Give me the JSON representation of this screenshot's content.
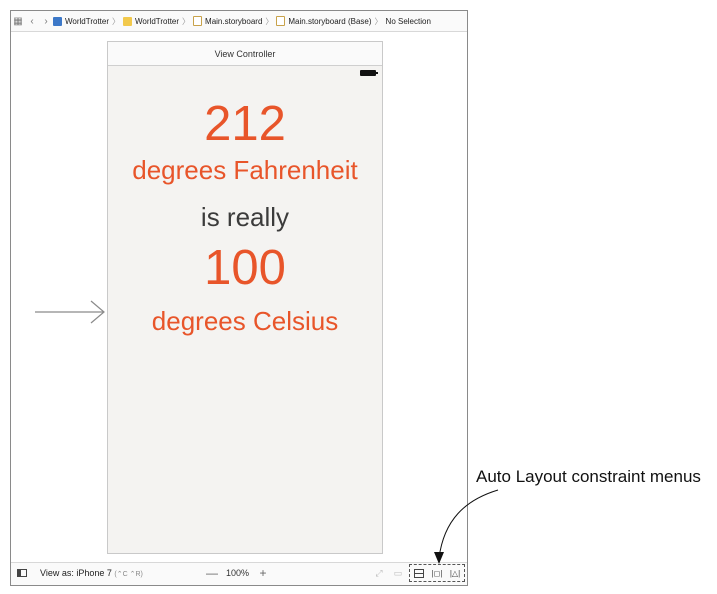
{
  "jumpbar": {
    "crumbs": [
      {
        "label": "WorldTrotter",
        "icon": "project-icon"
      },
      {
        "label": "WorldTrotter",
        "icon": "folder-icon"
      },
      {
        "label": "Main.storyboard",
        "icon": "storyboard-file-icon"
      },
      {
        "label": "Main.storyboard (Base)",
        "icon": "storyboard-file-icon"
      },
      {
        "label": "No Selection"
      }
    ]
  },
  "scene": {
    "title": "View Controller",
    "labels": {
      "fahrenheit_value": "212",
      "fahrenheit_unit": "degrees Fahrenheit",
      "connector": "is really",
      "celsius_value": "100",
      "celsius_unit": "degrees Celsius"
    },
    "colors": {
      "accent": "#e8552a",
      "text": "#3b3b3b",
      "background": "#f4f3f1"
    }
  },
  "bottom_bar": {
    "view_as": "View as: iPhone 7",
    "view_as_shortcut": "(⌃C  ⌃R)",
    "zoom": "100%",
    "zoom_out": "—",
    "zoom_in": "+"
  },
  "annotation": {
    "callout": "Auto Layout constraint menus"
  }
}
